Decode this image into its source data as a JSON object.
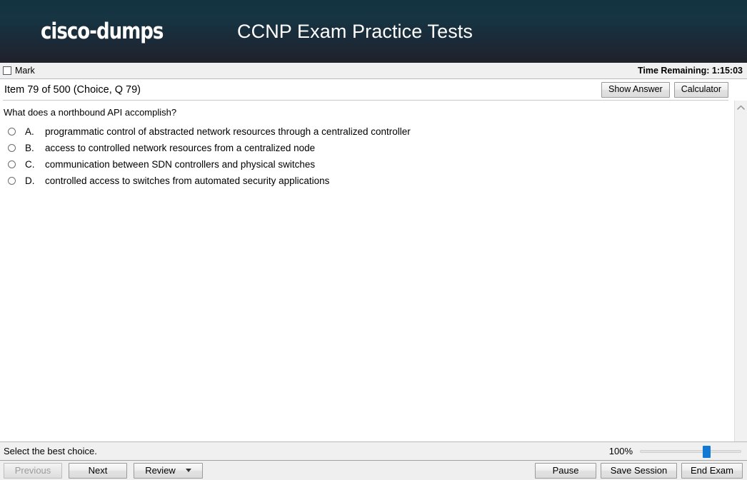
{
  "header": {
    "logo_text": "cisco-dumps",
    "title": "CCNP Exam Practice Tests"
  },
  "markbar": {
    "mark_label": "Mark",
    "mark_checked": false,
    "timer_text": "Time Remaining: 1:15:03"
  },
  "item_bar": {
    "item_label": "Item 79 of 500 (Choice, Q 79)",
    "show_answer_label": "Show Answer",
    "calculator_label": "Calculator"
  },
  "question": {
    "stem": "What does a northbound API accomplish?",
    "options": [
      {
        "letter": "A.",
        "text": "programmatic control of abstracted network resources through a centralized controller",
        "selected": false
      },
      {
        "letter": "B.",
        "text": "access to controlled network resources from a centralized node",
        "selected": false
      },
      {
        "letter": "C.",
        "text": "communication between SDN controllers and physical switches",
        "selected": false
      },
      {
        "letter": "D.",
        "text": "controlled access to switches from automated security applications",
        "selected": false
      }
    ]
  },
  "status_bar": {
    "hint_text": "Select the best choice.",
    "zoom_percent": "100%",
    "zoom_value": 100
  },
  "nav_bar": {
    "previous_label": "Previous",
    "previous_disabled": true,
    "next_label": "Next",
    "review_label": "Review",
    "pause_label": "Pause",
    "save_session_label": "Save Session",
    "end_exam_label": "End Exam"
  },
  "colors": {
    "header_top": "#143340",
    "header_bottom": "#20212b",
    "toolbar_bg": "#f0f0f0",
    "slider_thumb": "#1279d4",
    "content_bg": "#ffffff"
  },
  "icons": {
    "scroll_up": "chevron-up-icon",
    "review_caret": "chevron-down-icon",
    "mark_checkbox": "checkbox-icon"
  }
}
